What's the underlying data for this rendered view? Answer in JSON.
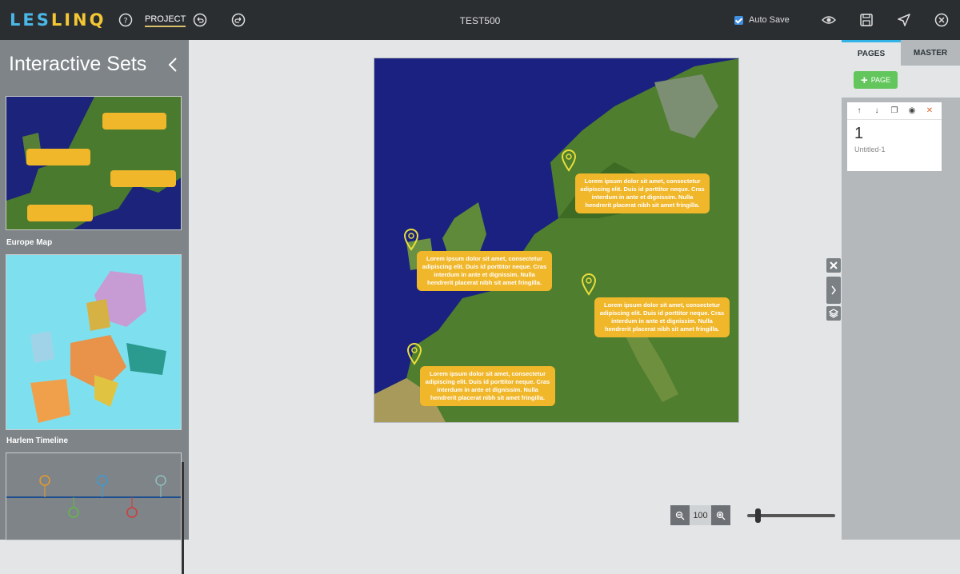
{
  "app": {
    "logo_part1": "LES",
    "logo_part2": "LINQ",
    "project_label": "PROJECT",
    "document_title": "TEST500",
    "autosave_label": "Auto Save"
  },
  "left_panel": {
    "title": "Interactive Sets",
    "items": [
      {
        "label": "Europe Map"
      },
      {
        "label": "Harlem Timeline"
      }
    ]
  },
  "map": {
    "callouts": [
      "Lorem ipsum dolor sit amet, consectetur adipiscing elit. Duis id porttitor neque. Cras interdum in ante et dignissim. Nulla hendrerit placerat nibh sit amet fringilla.",
      "Lorem ipsum dolor sit amet, consectetur adipiscing elit. Duis id porttitor neque. Cras interdum in ante et dignissim. Nulla hendrerit placerat nibh sit amet fringilla.",
      "Lorem ipsum dolor sit amet, consectetur adipiscing elit. Duis id porttitor neque. Cras interdum in ante et dignissim. Nulla hendrerit placerat nibh sit amet fringilla.",
      "Lorem ipsum dolor sit amet, consectetur adipiscing elit. Duis id porttitor neque. Cras interdum in ante et dignissim. Nulla hendrerit placerat nibh sit amet fringilla."
    ]
  },
  "right_panel": {
    "tabs": [
      "PAGES",
      "MASTER"
    ],
    "add_page_label": "PAGE",
    "page": {
      "number": "1",
      "name": "Untitled-1"
    }
  },
  "zoom": {
    "value": "100"
  },
  "colors": {
    "topbar": "#2b2e31",
    "accent_blue": "#31b3e8",
    "callout": "#f1b72b",
    "add_green": "#62c65d"
  }
}
